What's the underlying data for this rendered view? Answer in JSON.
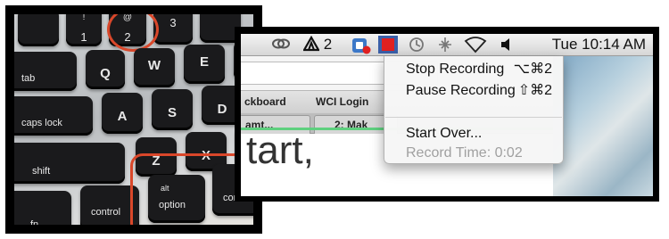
{
  "keyboard": {
    "keys": {
      "one": {
        "top": "!",
        "main": "1"
      },
      "two": {
        "top": "@",
        "main": "2"
      },
      "three": {
        "main": "3"
      },
      "q": "Q",
      "w": "W",
      "e": "E",
      "a": "A",
      "s": "S",
      "d": "D",
      "z": "Z",
      "x": "X",
      "tab": "tab",
      "caps_lock": "caps lock",
      "shift": "shift",
      "fn": "fn",
      "control": "control",
      "option": {
        "top": "alt",
        "main": "option"
      },
      "command": {
        "top": "⌘",
        "main": "command"
      }
    }
  },
  "menubar": {
    "indicator_label": "2",
    "clock": "Tue 10:14 AM"
  },
  "browser": {
    "bookmarks": [
      "ckboard",
      "WCI Login"
    ],
    "tabs": [
      "amt...",
      "2: Mak"
    ],
    "content_text": "tart,"
  },
  "menu": {
    "items": [
      {
        "label": "Stop Recording",
        "shortcut": "⌥⌘2"
      },
      {
        "label": "Pause Recording",
        "shortcut": "⇧⌘2"
      },
      {
        "label": "Start Over...",
        "shortcut": ""
      },
      {
        "label": "Record Time: 0:02",
        "shortcut": ""
      }
    ]
  },
  "colors": {
    "highlight": "#d9472a",
    "record_icon": "#e02020",
    "accent_bar": "#5fd07f"
  }
}
